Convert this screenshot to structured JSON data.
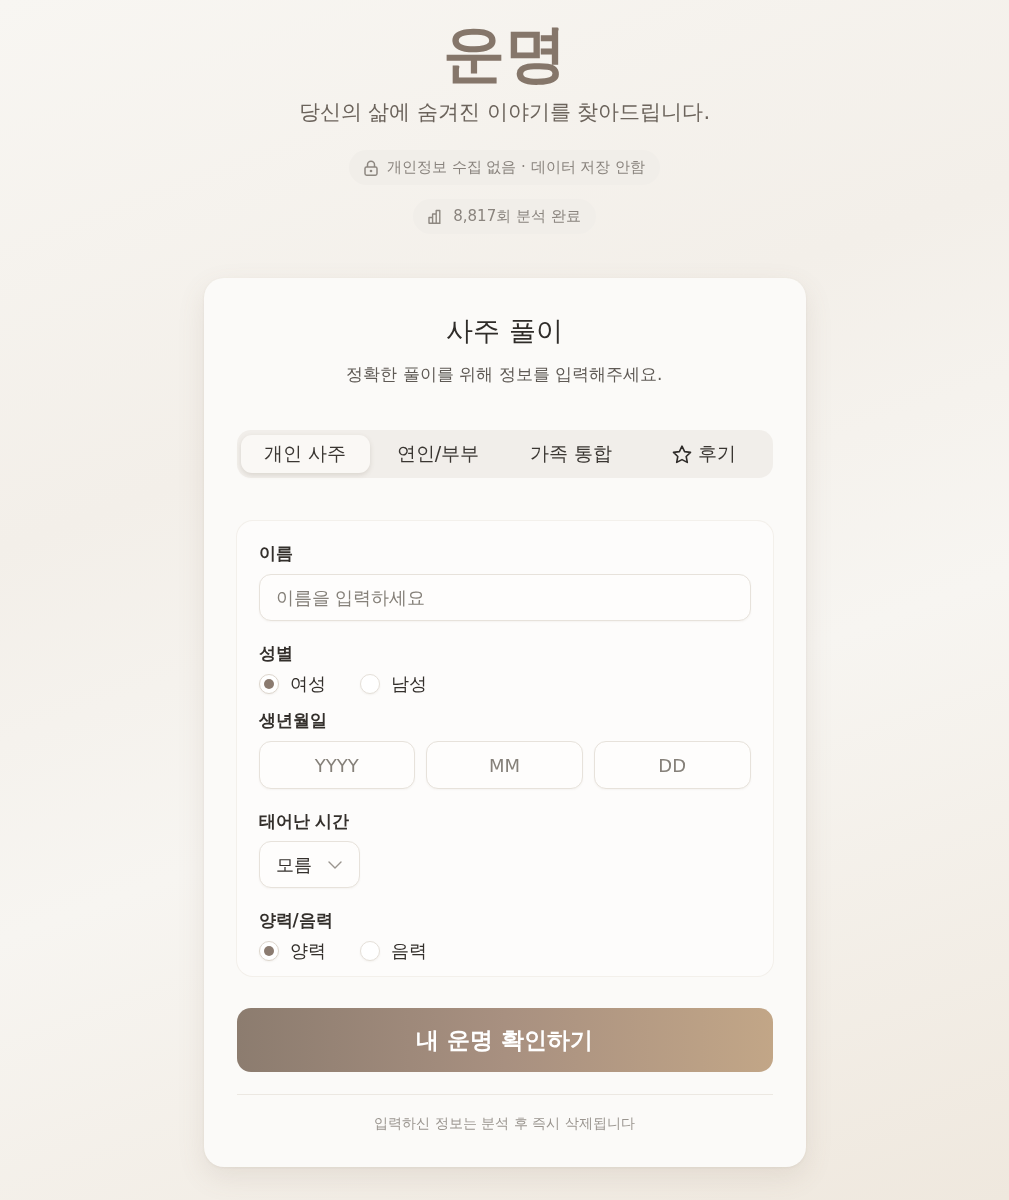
{
  "header": {
    "title": "운명",
    "tagline": "당신의 삶에 숨겨진 이야기를 찾아드립니다.",
    "badges": [
      {
        "kind": "privacy",
        "text": "개인정보 수집 없음 · 데이터 저장 안함"
      },
      {
        "kind": "stats",
        "text": "8,817회 분석 완료"
      }
    ]
  },
  "card": {
    "title": "사주 풀이",
    "subtitle": "정확한 풀이를 위해 정보를 입력해주세요.",
    "tabs": [
      {
        "kind": "form",
        "label": "개인 사주",
        "selected": true
      },
      {
        "kind": "form",
        "label": "연인/부부",
        "selected": false
      },
      {
        "kind": "form",
        "label": "가족 통합",
        "selected": false
      },
      {
        "kind": "reviews",
        "label": "후기",
        "selected": false
      }
    ],
    "fields": [
      {
        "kind": "text",
        "label": "이름",
        "placeholder": "이름을 입력하세요"
      },
      {
        "kind": "radio",
        "label": "성별",
        "options": [
          {
            "label": "여성",
            "selected": true
          },
          {
            "label": "남성",
            "selected": false
          }
        ]
      },
      {
        "kind": "date",
        "label": "생년월일",
        "parts": [
          {
            "placeholder": "YYYY"
          },
          {
            "placeholder": "MM"
          },
          {
            "placeholder": "DD"
          }
        ]
      },
      {
        "kind": "select",
        "label": "태어난 시간",
        "value": "모름"
      },
      {
        "kind": "radio",
        "label": "양력/음력",
        "options": [
          {
            "label": "양력",
            "selected": true
          },
          {
            "label": "음력",
            "selected": false
          }
        ]
      }
    ],
    "submit": "내 운명 확인하기",
    "note": "입력하신 정보는 분석 후 즉시 삭제됩니다"
  }
}
